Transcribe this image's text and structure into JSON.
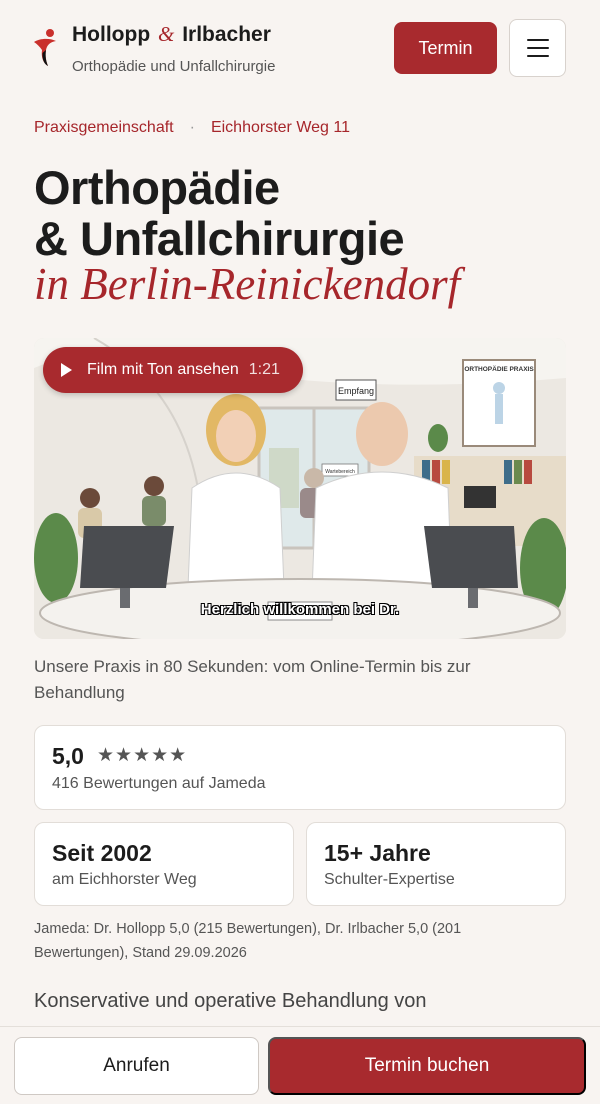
{
  "header": {
    "brand_name_part1": "Hollopp",
    "brand_amp": "&",
    "brand_name_part2": "Irlbacher",
    "brand_sub": "Orthopädie und Unfallchirurgie",
    "cta_label": "Termin",
    "menu_icon": "hamburger-icon",
    "accent_color": "#a82a2e"
  },
  "breadcrumb": {
    "item1": "Praxisgemeinschaft",
    "separator": "·",
    "item2": "Eichhorster Weg 11"
  },
  "hero": {
    "title_line1": "Orthopädie",
    "title_line2": "& Unfallchirurgie",
    "title_italic": "in Berlin-Reinickendorf"
  },
  "video": {
    "play_label": "Film mit Ton ansehen",
    "duration": "1:21",
    "subtitle": "Herzlich willkommen bei Dr.",
    "sign_reception": "Empfang",
    "sign_practice": "ORTHOPÄDIE PRAXIS",
    "sign_waiting": "Wartebereich",
    "caption": "Unsere Praxis in 80 Sekunden: vom Online-Termin bis zur Behandlung"
  },
  "rating": {
    "score": "5,0",
    "stars": "★★★★★",
    "count_text": "416 Bewertungen auf Jameda"
  },
  "stats": [
    {
      "title": "Seit 2002",
      "sub": "am Eichhorster Weg"
    },
    {
      "title": "15+ Jahre",
      "sub": "Schulter-Expertise"
    }
  ],
  "source_note": "Jameda: Dr. Hollopp 5,0 (215 Bewertungen), Dr. Irlbacher 5,0 (201 Bewertungen), Stand 29.09.2026",
  "intro_text": "Konservative und operative Behandlung von",
  "bottom_bar": {
    "call_label": "Anrufen",
    "book_label": "Termin buchen"
  }
}
